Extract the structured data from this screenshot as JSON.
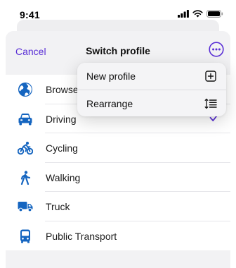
{
  "status_bar": {
    "time": "9:41",
    "icons": [
      "signal-icon",
      "wifi-icon",
      "battery-icon"
    ]
  },
  "nav": {
    "cancel_label": "Cancel",
    "title": "Switch profile",
    "more_icon": "ellipsis-circle-icon"
  },
  "profiles": [
    {
      "label": "Browse",
      "icon": "globe-icon",
      "selected": false
    },
    {
      "label": "Driving",
      "icon": "car-icon",
      "selected": true
    },
    {
      "label": "Cycling",
      "icon": "bicycle-icon",
      "selected": false
    },
    {
      "label": "Walking",
      "icon": "walking-icon",
      "selected": false
    },
    {
      "label": "Truck",
      "icon": "truck-icon",
      "selected": false
    },
    {
      "label": "Public Transport",
      "icon": "bus-icon",
      "selected": false
    }
  ],
  "menu": {
    "items": [
      {
        "label": "New profile",
        "icon": "plus-square-icon"
      },
      {
        "label": "Rearrange",
        "icon": "sort-list-icon"
      }
    ]
  },
  "colors": {
    "accent": "#5a2fd6",
    "icon_blue": "#1565c0",
    "sheet_bg": "#f2f2f4"
  }
}
